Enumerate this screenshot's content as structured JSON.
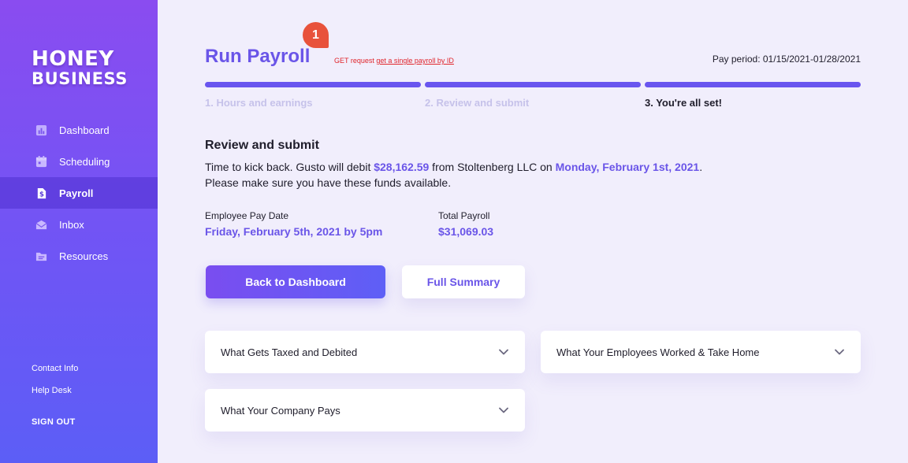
{
  "brand": {
    "line1": "HONEY",
    "line2": "BUSINESS"
  },
  "sidebar": {
    "items": [
      {
        "label": "Dashboard",
        "icon": "chart-icon",
        "active": false
      },
      {
        "label": "Scheduling",
        "icon": "calendar-icon",
        "active": false
      },
      {
        "label": "Payroll",
        "icon": "dollar-document-icon",
        "active": true
      },
      {
        "label": "Inbox",
        "icon": "envelope-icon",
        "active": false
      },
      {
        "label": "Resources",
        "icon": "folder-icon",
        "active": false
      }
    ],
    "links": [
      "Contact Info",
      "Help Desk"
    ],
    "signout": "SIGN OUT"
  },
  "header": {
    "title": "Run Payroll",
    "badge": "1",
    "api_note_prefix": "GET request ",
    "api_note_link": "get a single payroll by ID",
    "pay_period": "Pay period: 01/15/2021-01/28/2021"
  },
  "steps": [
    {
      "label": "1. Hours and earnings",
      "current": false
    },
    {
      "label": "2. Review and submit",
      "current": false
    },
    {
      "label": "3. You're all set!",
      "current": true
    }
  ],
  "review": {
    "heading": "Review and submit",
    "line1_a": "Time to kick back. Gusto will debit ",
    "amount": "$28,162.59",
    "line1_b": " from Stoltenberg LLC on ",
    "debit_date": "Monday, February 1st, 2021",
    "line1_c": ".",
    "line2": "Please make sure you have these funds available."
  },
  "info": {
    "pay_date_label": "Employee Pay Date",
    "pay_date_value": "Friday, February 5th, 2021 by 5pm",
    "total_label": "Total Payroll",
    "total_value": "$31,069.03"
  },
  "buttons": {
    "primary": "Back to Dashboard",
    "secondary": "Full Summary"
  },
  "accordions": [
    "What Gets Taxed and Debited",
    "What Your Employees Worked & Take Home",
    "What Your Company Pays"
  ],
  "colors": {
    "accent": "#6a55e8",
    "badge": "#e8523b",
    "background": "#f1eefc"
  }
}
